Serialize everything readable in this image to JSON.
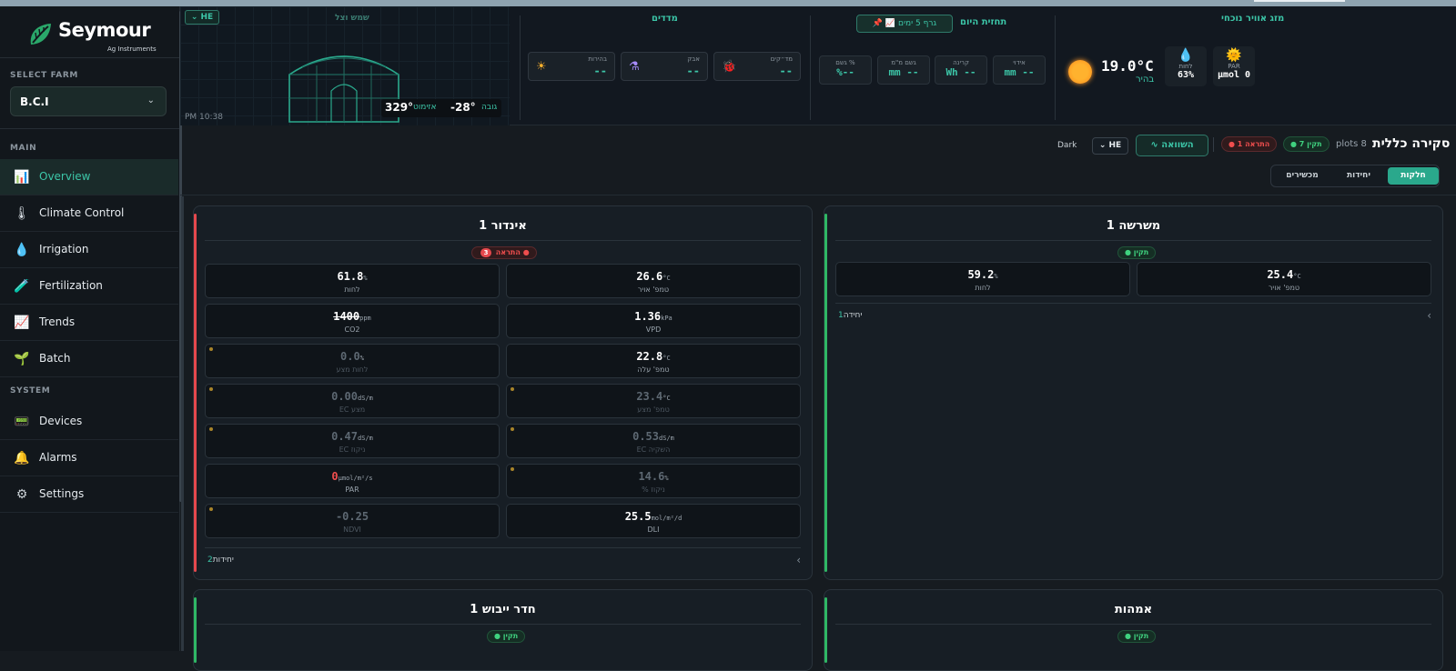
{
  "sidebar": {
    "brand": "Seymour",
    "brand_sub": "Ag Instruments",
    "select_farm_label": "SELECT FARM",
    "farm_value": "B.C.I",
    "main_label": "MAIN",
    "system_label": "SYSTEM",
    "items": [
      {
        "label": "Overview",
        "icon": "📊"
      },
      {
        "label": "Climate Control",
        "icon": "🌡"
      },
      {
        "label": "Irrigation",
        "icon": "💧"
      },
      {
        "label": "Fertilization",
        "icon": "🧪"
      },
      {
        "label": "Trends",
        "icon": "📈"
      },
      {
        "label": "Batch",
        "icon": "🌱"
      },
      {
        "label": "Devices",
        "icon": "📟"
      },
      {
        "label": "Alarms",
        "icon": "🔔"
      },
      {
        "label": "Settings",
        "icon": "⚙"
      }
    ]
  },
  "top": {
    "weather": {
      "title": "מזג אוויר נוכחי",
      "par_label": "PAR",
      "par_value": "μmol 0",
      "hum_label": "לחות",
      "hum_value": "63%",
      "temp": "19.0°C",
      "condition": "בהיר"
    },
    "forecast": {
      "title": "תחזית היום",
      "graph_btn": "📌 📈 גרף 5 ימים",
      "boxes": [
        {
          "label": "אידוי",
          "value": "mm --"
        },
        {
          "label": "קרינה",
          "value": "Wh --"
        },
        {
          "label": "גשם מ\"מ",
          "value": "mm --"
        },
        {
          "label": "גשם %",
          "value": "%--"
        }
      ]
    },
    "meters": {
      "title": "מדדים",
      "boxes": [
        {
          "label": "מד״קים",
          "value": "--",
          "icon": "🐞"
        },
        {
          "label": "אבק",
          "value": "--",
          "icon": "⚗"
        },
        {
          "label": "בהירות",
          "value": "--",
          "icon": "☀"
        }
      ]
    },
    "shade": {
      "title": "שמש וצל",
      "lang": "HE",
      "time": "PM 10:38",
      "height_label": "גובה",
      "height_value": "-28°",
      "azimuth_label": "אזימוט",
      "azimuth_value": "329°"
    }
  },
  "header": {
    "title": "סקירה כללית",
    "plots": "plots 8",
    "ok_pill": "● 7 תקין",
    "warn_pill": "● 1 התראה",
    "compare_btn": "השוואה",
    "lang": "HE",
    "theme": "Dark",
    "tabs": [
      "חלקות",
      "יחידות",
      "מכשירים"
    ]
  },
  "cards": [
    {
      "title": "משרשה 1",
      "badge": "● תקין",
      "metrics": [
        {
          "value": "25.4",
          "unit": "°C",
          "label": "טמפ' אויר"
        },
        {
          "value": "59.2",
          "unit": "%",
          "label": "לחות"
        }
      ],
      "footer_label": "יחידה",
      "footer_count": "1"
    },
    {
      "title": "אינדור 1",
      "badge": "התראה",
      "badge_count": "3",
      "metrics": [
        {
          "value": "26.6",
          "unit": "°C",
          "label": "טמפ' אויר"
        },
        {
          "value": "61.8",
          "unit": "%",
          "label": "לחות"
        },
        {
          "value": "1.36",
          "unit": "kPa",
          "label": "VPD"
        },
        {
          "value": "1400",
          "unit": "ppm",
          "label": "CO2"
        },
        {
          "value": "22.8",
          "unit": "°C",
          "label": "טמפ' עלה"
        },
        {
          "value": "0.0",
          "unit": "%",
          "label": "לחות מצע"
        },
        {
          "value": "23.4",
          "unit": "°C",
          "label": "טמפ' מצע"
        },
        {
          "value": "0.00",
          "unit": "dS/m",
          "label": "EC מצע"
        },
        {
          "value": "0.53",
          "unit": "dS/m",
          "label": "EC השקיה"
        },
        {
          "value": "0.47",
          "unit": "dS/m",
          "label": "EC ניקוז"
        },
        {
          "value": "14.6",
          "unit": "%",
          "label": "% ניקוז"
        },
        {
          "value": "0",
          "unit": "μmol/m²/s",
          "label": "PAR"
        },
        {
          "value": "25.5",
          "unit": "mol/m²/d",
          "label": "DLI"
        },
        {
          "value": "-0.25",
          "unit": "",
          "label": "NDVI"
        }
      ],
      "footer_label": "יחידות",
      "footer_count": "2"
    },
    {
      "title": "אמהות",
      "badge": "● תקין"
    },
    {
      "title": "חדר ייבוש 1",
      "badge": "● תקין"
    }
  ]
}
